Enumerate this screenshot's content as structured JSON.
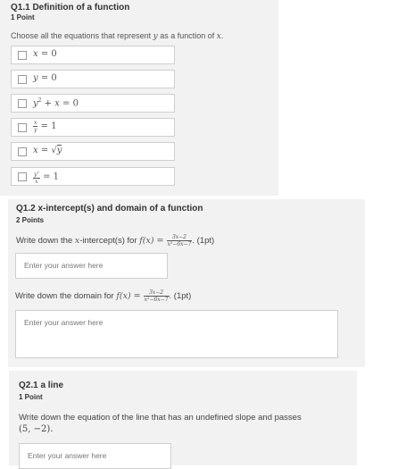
{
  "q1": {
    "title": "Q1.1 Definition of a function",
    "points": "1 Point",
    "prompt_prefix": "Choose all the equations that represent ",
    "prompt_var_y": "y",
    "prompt_mid": " as a function of ",
    "prompt_var_x": "x",
    "prompt_end": ".",
    "options": [
      "x = 0",
      "y = 0",
      "y² + x = 0",
      "x/y = 1",
      "x = √y",
      "y²/x = 1"
    ]
  },
  "q2": {
    "title": "Q1.2 x-intercept(s) and domain of a function",
    "points": "2 Points",
    "part1_prefix": "Write down the ",
    "part1_var": "x",
    "part1_mid": "-intercept(s) for ",
    "part2_prefix": "Write down the domain for ",
    "func": "f(x) = ",
    "numerator": "3x−2",
    "denominator": "x²−6x−7",
    "pts_label": ". (1pt)",
    "answer_placeholder": "Enter your answer here"
  },
  "q3": {
    "title": "Q2.1 a line",
    "points": "1 Point",
    "prompt_line1": "Write down the equation of the line that has an undefined slope and passes",
    "prompt_line2": "(5, −2).",
    "answer_placeholder": "Enter your answer here"
  }
}
